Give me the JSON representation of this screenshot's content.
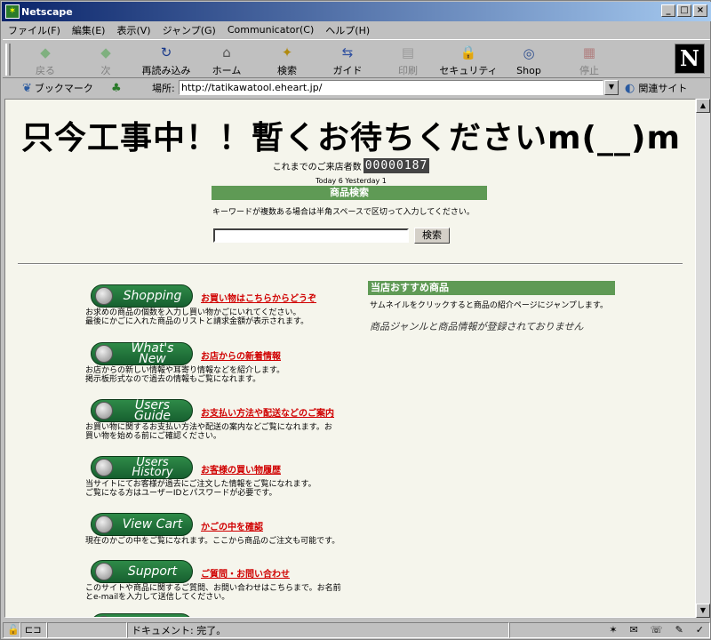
{
  "window": {
    "title": "Netscape"
  },
  "menu": [
    "ファイル(F)",
    "編集(E)",
    "表示(V)",
    "ジャンプ(G)",
    "Communicator(C)",
    "ヘルプ(H)"
  ],
  "toolbar": [
    {
      "label": "戻る",
      "icon": "back-icon",
      "enabled": false
    },
    {
      "label": "次",
      "icon": "forward-icon",
      "enabled": false
    },
    {
      "label": "再読み込み",
      "icon": "reload-icon",
      "enabled": true
    },
    {
      "label": "ホーム",
      "icon": "home-icon",
      "enabled": true
    },
    {
      "label": "検索",
      "icon": "search-icon",
      "enabled": true
    },
    {
      "label": "ガイド",
      "icon": "guide-icon",
      "enabled": true
    },
    {
      "label": "印刷",
      "icon": "print-icon",
      "enabled": false
    },
    {
      "label": "セキュリティ",
      "icon": "security-icon",
      "enabled": true
    },
    {
      "label": "Shop",
      "icon": "shop-icon",
      "enabled": true
    },
    {
      "label": "停止",
      "icon": "stop-icon",
      "enabled": false
    }
  ],
  "location": {
    "bookmarks_label": "ブックマーク",
    "label": "場所:",
    "url": "http://tatikawatool.eheart.jp/",
    "related_label": "関連サイト"
  },
  "page": {
    "heading": "只今工事中！！暫くお待ちくださいm(__)m",
    "counter_label": "これまでのご来店者数",
    "counter_value": "00000187",
    "today_text": "Today 6  Yesterday 1",
    "search": {
      "header": "商品検索",
      "note": "キーワードが複数ある場合は半角スペースで区切って入力してください。",
      "value": "",
      "button": "検索"
    },
    "nav": [
      {
        "button": "Shopping",
        "link": "お買い物はこちらからどうぞ",
        "desc": "お求めの商品の個数を入力し買い物かごにいれてください。\n最後にかごに入れた商品のリストと請求金額が表示されます。"
      },
      {
        "button": "What's New",
        "link": "お店からの新着情報",
        "desc": "お店からの新しい情報や耳寄り情報などを紹介します。\n掲示板形式なので過去の情報もご覧になれます。"
      },
      {
        "button": "Users Guide",
        "link": "お支払い方法や配送などのご案内",
        "desc": "お買い物に関するお支払い方法や配送の案内などご覧になれます。お\n買い物を始める前にご確認ください。"
      },
      {
        "button": "Users\nHistory",
        "link": "お客様の買い物履歴",
        "desc": "当サイトにてお客様が過去にご注文した情報をご覧になれます。\nご覧になる方はユーザーIDとパスワードが必要です。"
      },
      {
        "button": "View Cart",
        "link": "かごの中を確認",
        "desc": "現在のかごの中をご覧になれます。ここから商品のご注文も可能です。"
      },
      {
        "button": "Support",
        "link": "ご質問・お問い合わせ",
        "desc": "このサイトや商品に関するご質問、お問い合わせはこちらまで。お名前\nとe-mailを入力して送信してください。"
      }
    ],
    "recommend": {
      "header": "当店おすすめ商品",
      "note": "サムネイルをクリックすると商品の紹介ページにジャンプします。",
      "empty": "商品ジャンルと商品情報が登録されておりません"
    }
  },
  "status": {
    "text": "ドキュメント: 完了。"
  }
}
